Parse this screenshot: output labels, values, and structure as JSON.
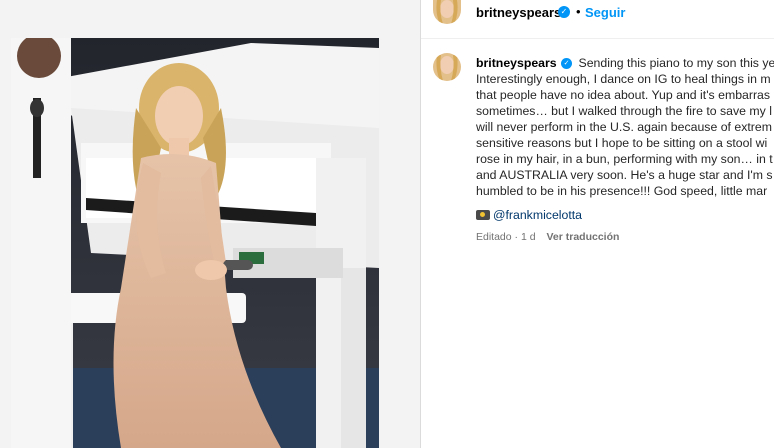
{
  "header": {
    "username": "britneyspears",
    "separator": "•",
    "follow_label": "Seguir"
  },
  "post": {
    "username": "britneyspears",
    "caption_lines": [
      "Sending this piano to my son this yea",
      "Interestingly enough, I dance on IG to heal things in m",
      "that people have no idea about. Yup and it's embarras",
      "sometimes… but I walked through the fire to save my l",
      "will never perform in the U.S. again because of extrem",
      "sensitive reasons but I hope to be sitting on a stool wi",
      "rose in my hair, in a bun, performing with my son… in t",
      "and AUSTRALIA very soon. He's a huge star and I'm s",
      "humbled to be in his presence!!! God speed, little mar"
    ],
    "credit_handle": "@frankmicelotta",
    "edited_label": "Editado · 1 d",
    "translate_label": "Ver traducción"
  },
  "colors": {
    "accent": "#0095f6",
    "link": "#00376b",
    "meta": "#737373"
  },
  "icons": {
    "verified": "verified-badge-icon",
    "camera": "camera-icon"
  }
}
